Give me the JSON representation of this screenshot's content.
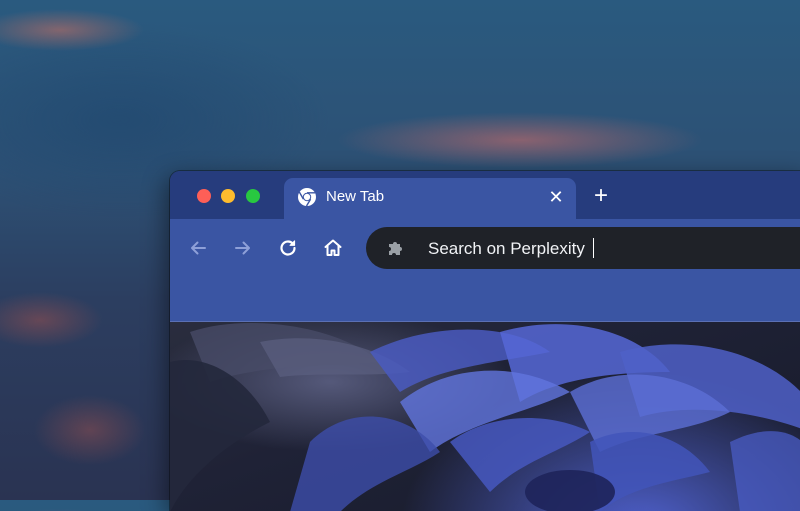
{
  "browser": {
    "tab": {
      "title": "New Tab",
      "icon": "chrome-icon",
      "close_icon": "close-icon"
    },
    "new_tab_icon": "plus-icon",
    "toolbar": {
      "back_icon": "back-arrow-icon",
      "forward_icon": "forward-arrow-icon",
      "reload_icon": "reload-icon",
      "home_icon": "home-icon"
    },
    "omnibox": {
      "icon": "extension-puzzle-icon",
      "text": "Search on Perplexity"
    }
  },
  "colors": {
    "toolbar": "#3a55a3",
    "titlebar": "#263c7d",
    "omnibox": "#1f2228",
    "traffic_close": "#fe5f57",
    "traffic_minimize": "#febc2e",
    "traffic_maximize": "#28c840"
  }
}
